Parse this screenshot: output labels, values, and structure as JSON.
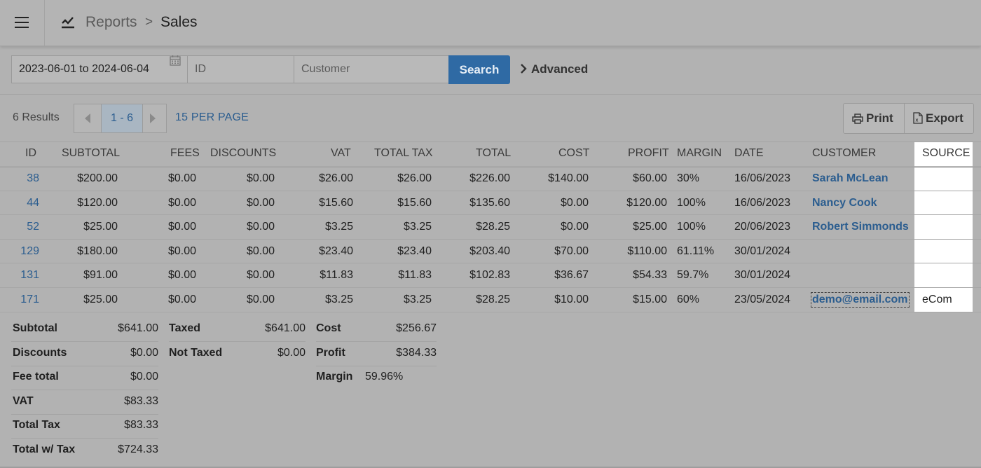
{
  "header": {
    "breadcrumb_reports": "Reports",
    "breadcrumb_sep": ">",
    "breadcrumb_sales": "Sales"
  },
  "filters": {
    "date_range": "2023-06-01 to 2024-06-04",
    "id_placeholder": "ID",
    "customer_placeholder": "Customer",
    "search_label": "Search",
    "advanced_label": "Advanced"
  },
  "pagination": {
    "results": "6 Results",
    "range": "1 - 6",
    "per_page": "15 PER PAGE"
  },
  "actions": {
    "print": "Print",
    "export": "Export"
  },
  "table": {
    "columns": [
      "ID",
      "SUBTOTAL",
      "FEES",
      "DISCOUNTS",
      "VAT",
      "TOTAL TAX",
      "TOTAL",
      "COST",
      "PROFIT",
      "MARGIN",
      "DATE",
      "CUSTOMER",
      "SOURCE"
    ],
    "rows": [
      {
        "id": "38",
        "subtotal": "$200.00",
        "fees": "$0.00",
        "discounts": "$0.00",
        "vat": "$26.00",
        "total_tax": "$26.00",
        "total": "$226.00",
        "cost": "$140.00",
        "profit": "$60.00",
        "margin": "30%",
        "date": "16/06/2023",
        "customer": "Sarah McLean",
        "source": ""
      },
      {
        "id": "44",
        "subtotal": "$120.00",
        "fees": "$0.00",
        "discounts": "$0.00",
        "vat": "$15.60",
        "total_tax": "$15.60",
        "total": "$135.60",
        "cost": "$0.00",
        "profit": "$120.00",
        "margin": "100%",
        "date": "16/06/2023",
        "customer": "Nancy Cook",
        "source": ""
      },
      {
        "id": "52",
        "subtotal": "$25.00",
        "fees": "$0.00",
        "discounts": "$0.00",
        "vat": "$3.25",
        "total_tax": "$3.25",
        "total": "$28.25",
        "cost": "$0.00",
        "profit": "$25.00",
        "margin": "100%",
        "date": "20/06/2023",
        "customer": "Robert Simmonds",
        "source": ""
      },
      {
        "id": "129",
        "subtotal": "$180.00",
        "fees": "$0.00",
        "discounts": "$0.00",
        "vat": "$23.40",
        "total_tax": "$23.40",
        "total": "$203.40",
        "cost": "$70.00",
        "profit": "$110.00",
        "margin": "61.11%",
        "date": "30/01/2024",
        "customer": "",
        "source": ""
      },
      {
        "id": "131",
        "subtotal": "$91.00",
        "fees": "$0.00",
        "discounts": "$0.00",
        "vat": "$11.83",
        "total_tax": "$11.83",
        "total": "$102.83",
        "cost": "$36.67",
        "profit": "$54.33",
        "margin": "59.7%",
        "date": "30/01/2024",
        "customer": "",
        "source": ""
      },
      {
        "id": "171",
        "subtotal": "$25.00",
        "fees": "$0.00",
        "discounts": "$0.00",
        "vat": "$3.25",
        "total_tax": "$3.25",
        "total": "$28.25",
        "cost": "$10.00",
        "profit": "$15.00",
        "margin": "60%",
        "date": "23/05/2024",
        "customer": "demo@email.com",
        "source": "eCom"
      }
    ]
  },
  "summary": {
    "col1": [
      {
        "label": "Subtotal",
        "value": "$641.00"
      },
      {
        "label": "Discounts",
        "value": "$0.00"
      },
      {
        "label": "Fee total",
        "value": "$0.00"
      },
      {
        "label": "VAT",
        "value": "$83.33"
      },
      {
        "label": "Total Tax",
        "value": "$83.33"
      },
      {
        "label": "Total w/ Tax",
        "value": "$724.33"
      }
    ],
    "col2": [
      {
        "label": "Taxed",
        "value": "$641.00"
      },
      {
        "label": "Not Taxed",
        "value": "$0.00"
      }
    ],
    "col3": [
      {
        "label": "Cost",
        "value": "$256.67"
      },
      {
        "label": "Profit",
        "value": "$384.33"
      },
      {
        "label": "Margin",
        "value": "59.96%"
      }
    ]
  },
  "colors": {
    "accent": "#2f6aa4",
    "link": "#2b5d8f",
    "background": "#b2b2b2"
  }
}
